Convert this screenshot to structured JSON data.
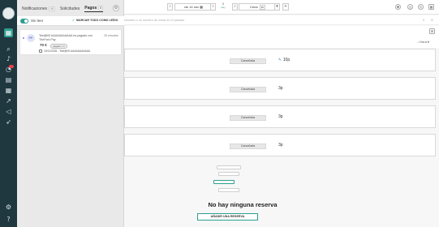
{
  "rail": {
    "icons": [
      "search-icon",
      "bell-icon",
      "alert-icon",
      "book-icon",
      "calendar-icon",
      "chart-icon",
      "megaphone-icon",
      "rocket-icon",
      "settings-icon",
      "help-icon"
    ]
  },
  "notifications": {
    "tabs": [
      {
        "label": "Notificaciones",
        "count": "44"
      },
      {
        "label": "Solicitudes",
        "count": ""
      },
      {
        "label": "Pagos",
        "count": "0"
      }
    ],
    "toggle_label": "Sin leer",
    "mark_all": "MARCAR TODO COMO LEÍDO",
    "items": [
      {
        "avatar": "PP",
        "title": "Test@00 AAAAAAAAAAA ha pagado con TheFork Pay",
        "time": "25 minutos",
        "amount": "70 €",
        "pill": "pagado x 1",
        "date": "15/11/2025 - Test@00 AAAAAAAAAAA"
      }
    ]
  },
  "topbar": {
    "date": "vie 14 nov",
    "today_label": "Hoy",
    "today_count": "0",
    "room": "Cena",
    "room_count": "35"
  },
  "search": {
    "placeholder": "Nombre o un número de mesa en el pasado"
  },
  "sort": {
    "label": "Hora"
  },
  "rows": [
    {
      "status": "Cancelada",
      "value": "10p",
      "icon": "brush-icon"
    },
    {
      "status": "Cancelada",
      "value": "3p"
    },
    {
      "status": "Cancelada",
      "value": "3p"
    },
    {
      "status": "Cancelada",
      "value": "3p"
    }
  ],
  "empty": {
    "title": "No hay ninguna reserva",
    "button": "AÑADIR UNA RESERVA"
  },
  "colors": {
    "accent": "#2f9e8f",
    "rail": "#1f3840",
    "danger": "#e2424a"
  }
}
